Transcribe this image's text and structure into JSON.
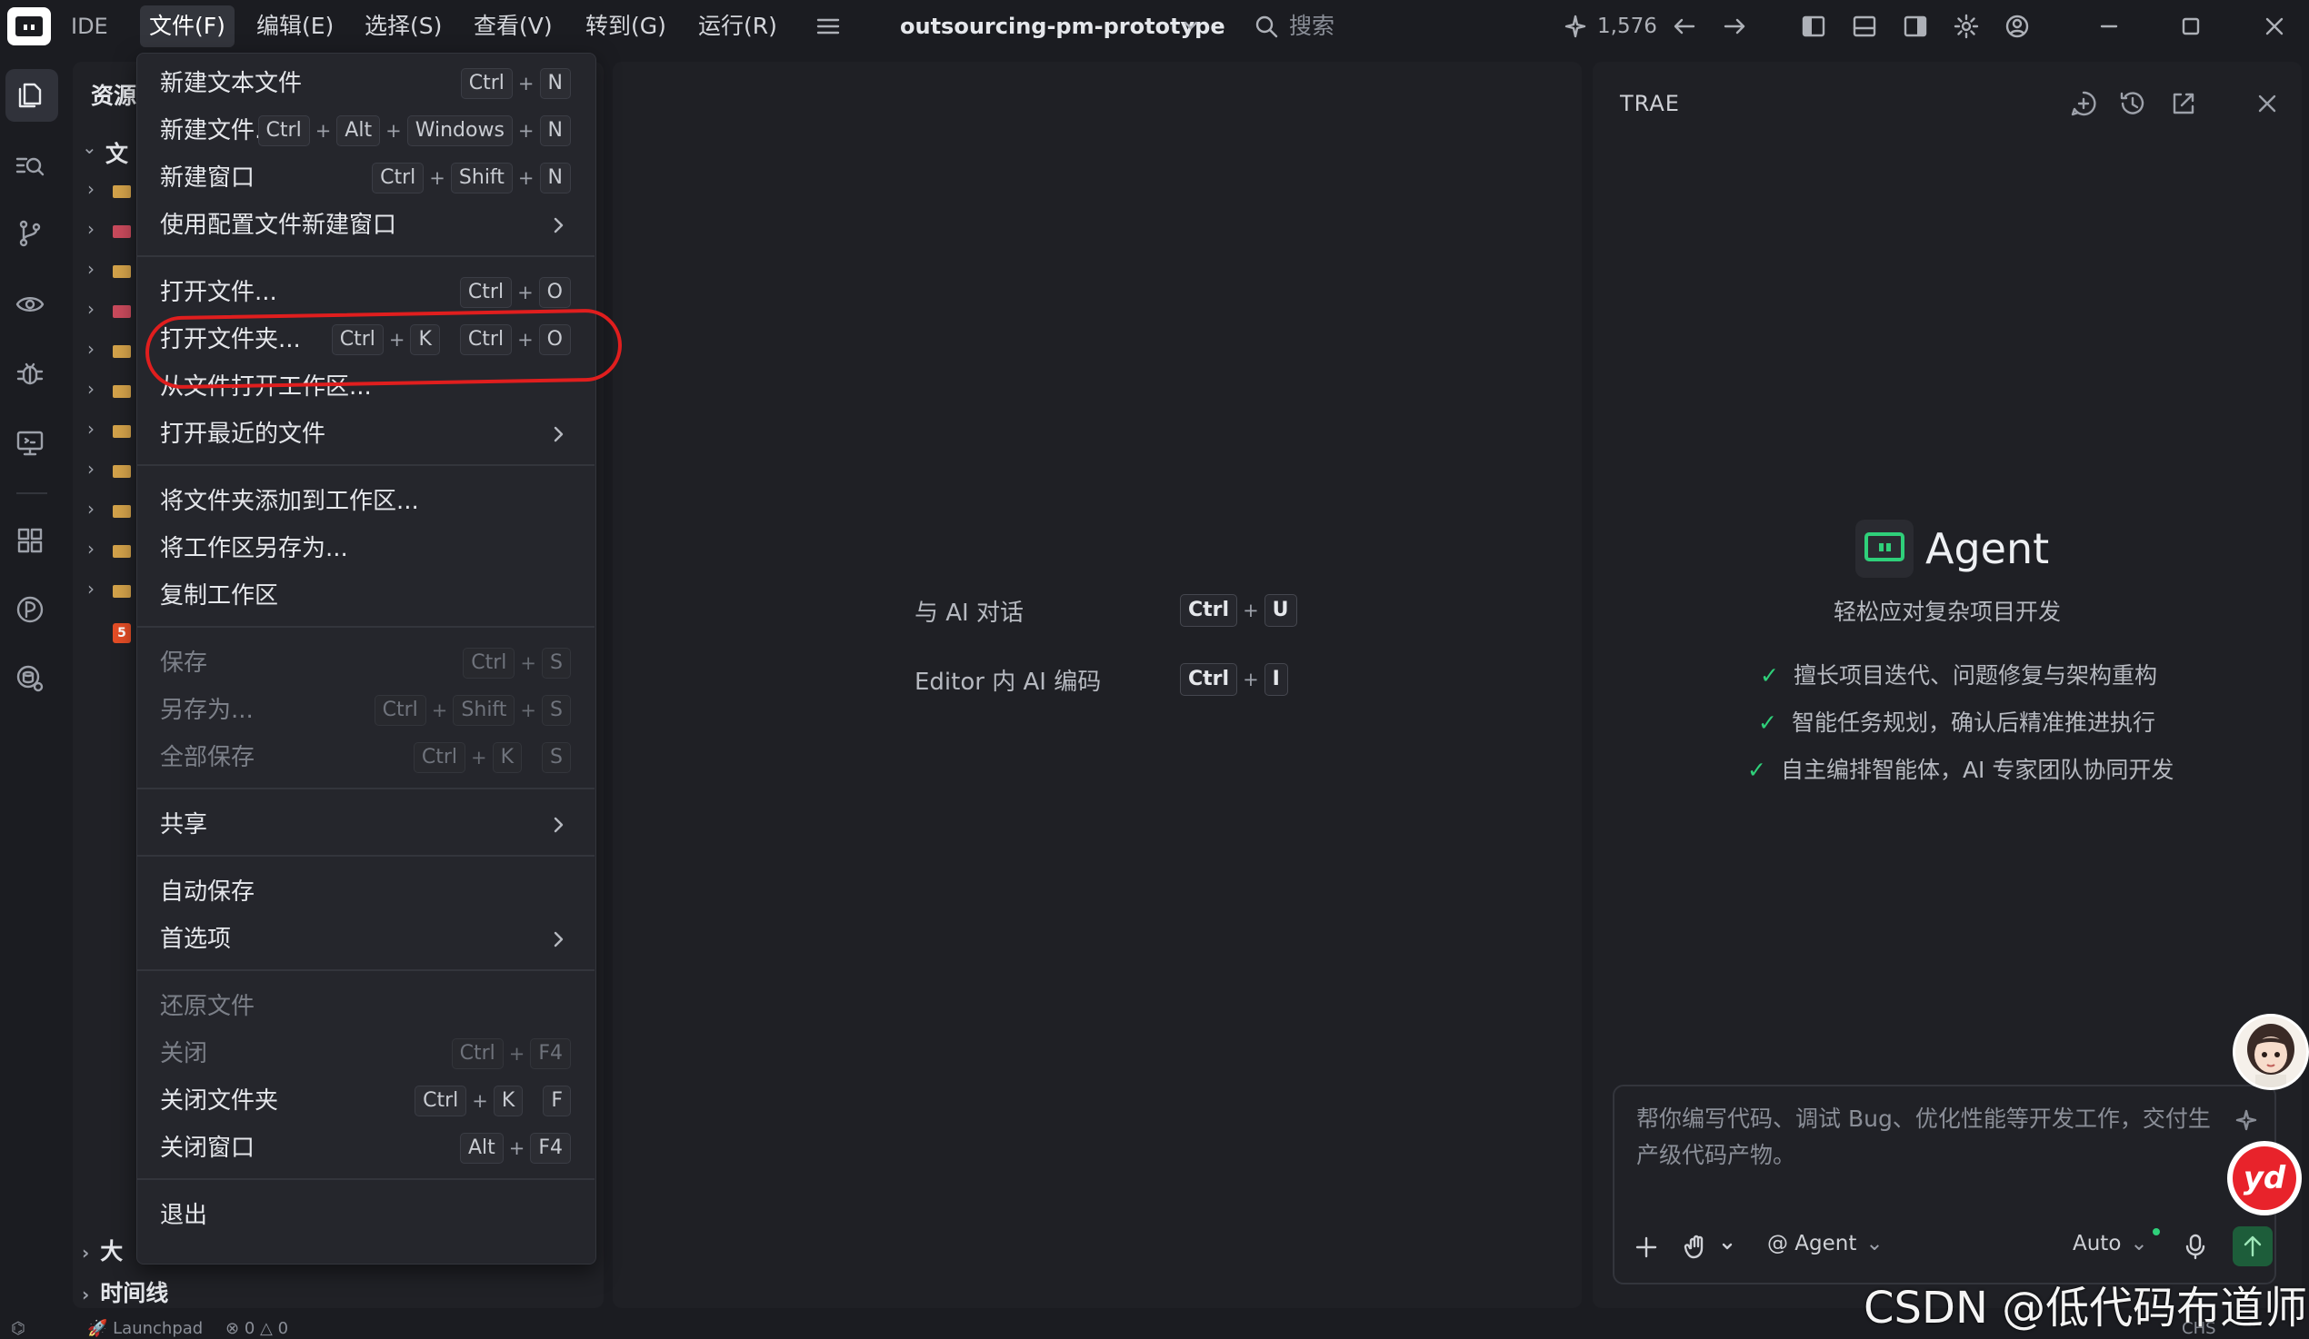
{
  "titlebar": {
    "ide_label": "IDE",
    "menus": [
      "文件(F)",
      "编辑(E)",
      "选择(S)",
      "查看(V)",
      "转到(G)",
      "运行(R)"
    ],
    "project": "outsourcing-pm-prototype",
    "search_placeholder": "搜索",
    "credits": "1,576"
  },
  "explorer": {
    "title": "资源",
    "root_folder": "文",
    "bottom_sections": [
      "大纲",
      "时间线"
    ],
    "outline_partial": "大",
    "timeline": "时间线",
    "html_badge": "5"
  },
  "file_menu": {
    "groups": [
      [
        {
          "label": "新建文本文件",
          "shortcut": [
            [
              "Ctrl",
              "N"
            ]
          ],
          "disabled": false,
          "submenu": false
        },
        {
          "label": "新建文件...",
          "shortcut": [
            [
              "Ctrl",
              "Alt",
              "Windows",
              "N"
            ]
          ],
          "disabled": false,
          "submenu": false
        },
        {
          "label": "新建窗口",
          "shortcut": [
            [
              "Ctrl",
              "Shift",
              "N"
            ]
          ],
          "disabled": false,
          "submenu": false
        },
        {
          "label": "使用配置文件新建窗口",
          "shortcut": [],
          "disabled": false,
          "submenu": true
        }
      ],
      [
        {
          "label": "打开文件...",
          "shortcut": [
            [
              "Ctrl",
              "O"
            ]
          ],
          "disabled": false,
          "submenu": false
        },
        {
          "label": "打开文件夹...",
          "shortcut": [
            [
              "Ctrl",
              "K"
            ],
            [
              "Ctrl",
              "O"
            ]
          ],
          "disabled": false,
          "submenu": false,
          "highlighted": true
        },
        {
          "label": "从文件打开工作区...",
          "shortcut": [],
          "disabled": false,
          "submenu": false
        },
        {
          "label": "打开最近的文件",
          "shortcut": [],
          "disabled": false,
          "submenu": true
        }
      ],
      [
        {
          "label": "将文件夹添加到工作区...",
          "shortcut": [],
          "disabled": false,
          "submenu": false
        },
        {
          "label": "将工作区另存为...",
          "shortcut": [],
          "disabled": false,
          "submenu": false
        },
        {
          "label": "复制工作区",
          "shortcut": [],
          "disabled": false,
          "submenu": false
        }
      ],
      [
        {
          "label": "保存",
          "shortcut": [
            [
              "Ctrl",
              "S"
            ]
          ],
          "disabled": true,
          "submenu": false
        },
        {
          "label": "另存为...",
          "shortcut": [
            [
              "Ctrl",
              "Shift",
              "S"
            ]
          ],
          "disabled": true,
          "submenu": false
        },
        {
          "label": "全部保存",
          "shortcut": [
            [
              "Ctrl",
              "K"
            ],
            [
              "S"
            ]
          ],
          "disabled": true,
          "submenu": false
        }
      ],
      [
        {
          "label": "共享",
          "shortcut": [],
          "disabled": false,
          "submenu": true
        }
      ],
      [
        {
          "label": "自动保存",
          "shortcut": [],
          "disabled": false,
          "submenu": false
        },
        {
          "label": "首选项",
          "shortcut": [],
          "disabled": false,
          "submenu": true
        }
      ],
      [
        {
          "label": "还原文件",
          "shortcut": [],
          "disabled": true,
          "submenu": false
        },
        {
          "label": "关闭",
          "shortcut": [
            [
              "Ctrl",
              "F4"
            ]
          ],
          "disabled": true,
          "submenu": false
        },
        {
          "label": "关闭文件夹",
          "shortcut": [
            [
              "Ctrl",
              "K"
            ],
            [
              "F"
            ]
          ],
          "disabled": false,
          "submenu": false
        },
        {
          "label": "关闭窗口",
          "shortcut": [
            [
              "Alt",
              "F4"
            ]
          ],
          "disabled": false,
          "submenu": false
        }
      ],
      [
        {
          "label": "退出",
          "shortcut": [],
          "disabled": false,
          "submenu": false
        }
      ]
    ]
  },
  "editor": {
    "hints": [
      {
        "label": "与 AI 对话",
        "keys": [
          "Ctrl",
          "U"
        ]
      },
      {
        "label": "Editor 内 AI 编码",
        "keys": [
          "Ctrl",
          "I"
        ]
      }
    ]
  },
  "agent_panel": {
    "header": "TRAE",
    "title": "Agent",
    "subtitle": "轻松应对复杂项目开发",
    "features": [
      "擅长项目迭代、问题修复与架构重构",
      "智能任务规划，确认后精准推进执行",
      "自主编排智能体，AI 专家团队协同开发"
    ],
    "input_placeholder": "帮你编写代码、调试 Bug、优化性能等开发工作，交付生产级代码产物。",
    "mode_label": "@ Agent",
    "model_label": "Auto"
  },
  "overlay": {
    "yd_badge": "yd",
    "watermark": "CSDN @低代码布道师"
  },
  "statusbar": {
    "launchpad": "Launchpad",
    "errors": "0",
    "warnings": "0",
    "lang": "CHS"
  },
  "colors": {
    "accent_green": "#2fd07a",
    "highlight_red": "#e01e1e",
    "menu_bg": "#25262c",
    "app_bg": "#1b1c21"
  }
}
